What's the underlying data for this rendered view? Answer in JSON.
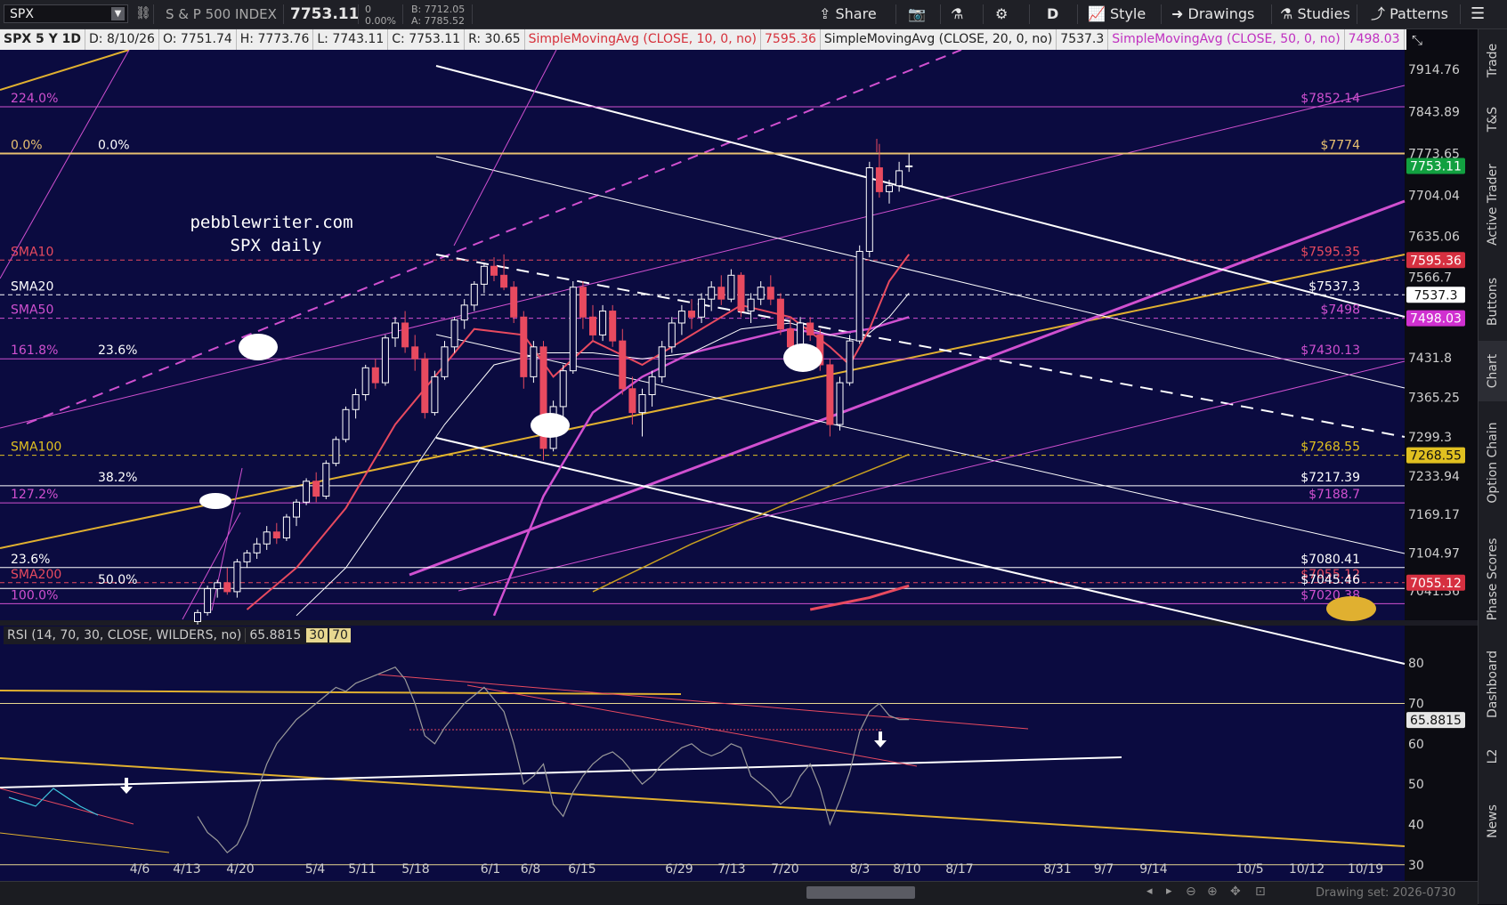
{
  "toolbar": {
    "symbol": "SPX",
    "description": "S & P 500 INDEX",
    "last": "7753.11",
    "change": "0",
    "change_pct": "0.00%",
    "bid": "B: 7712.05",
    "ask": "A: 7785.52",
    "share": "Share",
    "period": "D",
    "style": "Style",
    "drawings": "Drawings",
    "studies": "Studies",
    "patterns": "Patterns"
  },
  "info": {
    "chart_id": "SPX 5 Y 1D",
    "date": "D: 8/10/26",
    "open": "O: 7751.74",
    "high": "H: 7773.76",
    "low": "L: 7743.11",
    "close": "C: 7753.11",
    "range": "R: 30.65",
    "sma10_label": "SimpleMovingAvg (CLOSE, 10, 0, no)",
    "sma10_val": "7595.36",
    "sma20_label": "SimpleMovingAvg (CLOSE, 20, 0, no)",
    "sma20_val": "7537.3",
    "sma50_label": "SimpleMovingAvg (CLOSE, 50, 0, no)",
    "sma50_val": "7498.03"
  },
  "sidebar": [
    "Trade",
    "T&S",
    "Active Trader",
    "Buttons",
    "Chart",
    "Option Chain",
    "Phase Scores",
    "Dashboard",
    "L2",
    "News"
  ],
  "bottom": {
    "drawing_set": "Drawing set: 2026-0730"
  },
  "colors": {
    "bg": "#0b0b3f",
    "up": "#ffffff",
    "down": "#e84a5f",
    "fib": "#d050d0",
    "gold": "#e0b030",
    "grid": "#ffffff"
  },
  "chart_data": [
    {
      "type": "candlestick",
      "title": "SPX daily",
      "watermark": "pebblewriter.com",
      "price_axis": [
        "7914.76",
        "7843.89",
        "7773.65",
        "7704.04",
        "7635.06",
        "7566.7",
        "7498.03",
        "7431.8",
        "7365.25",
        "7299.3",
        "7233.94",
        "7169.17",
        "7104.97",
        "7041.36"
      ],
      "date_axis": [
        "4/6",
        "4/13",
        "4/20",
        "5/4",
        "5/11",
        "5/18",
        "6/1",
        "6/8",
        "6/15",
        "6/29",
        "7/13",
        "7/20",
        "8/3",
        "8/10",
        "8/17",
        "8/31",
        "9/7",
        "9/14",
        "10/5",
        "10/12",
        "10/19"
      ],
      "badges": [
        {
          "label": "7753.11",
          "color": "#12a040"
        },
        {
          "label": "7595.36",
          "color": "#d63040"
        },
        {
          "label": "7537.3",
          "color": "#ffffff"
        },
        {
          "label": "7498.03",
          "color": "#d030d0"
        },
        {
          "label": "7268.55",
          "color": "#e0c020"
        },
        {
          "label": "7055.12",
          "color": "#d63040"
        }
      ],
      "hlines": [
        {
          "price": 7852.14,
          "color": "#d050d0",
          "left": "224.0%",
          "right": "$7852.14"
        },
        {
          "price": 7774,
          "color": "#e8c070",
          "left": "0.0%",
          "mid": "0.0%",
          "right": "$7774"
        },
        {
          "price": 7595.36,
          "color": "#e84a5f",
          "left": "SMA10",
          "right": "$7595.35",
          "dashed": true
        },
        {
          "price": 7537.3,
          "color": "#ffffff",
          "left": "SMA20",
          "right": "$7537.3",
          "dashed": true
        },
        {
          "price": 7498,
          "color": "#d050d0",
          "left": "SMA50",
          "right": "$7498",
          "dashed": true
        },
        {
          "price": 7430,
          "color": "#d050d0",
          "left": "161.8%",
          "mid": "23.6%",
          "right": "$7430.13"
        },
        {
          "price": 7268.55,
          "color": "#e0c020",
          "left": "SMA100",
          "right": "$7268.55",
          "dashed": true
        },
        {
          "price": 7217.39,
          "color": "#ffffff",
          "mid": "38.2%",
          "right": "$7217.39"
        },
        {
          "price": 7188.7,
          "color": "#d050d0",
          "left": "127.2%",
          "right": "$7188.7"
        },
        {
          "price": 7080.41,
          "color": "#ffffff",
          "left": "23.6%",
          "right": "$7080.41"
        },
        {
          "price": 7055.12,
          "color": "#e84a5f",
          "left": "SMA200",
          "right": "$7055.12",
          "dashed": true
        },
        {
          "price": 7045.46,
          "color": "#ffffff",
          "mid": "50.0%",
          "right": "$7045.46"
        },
        {
          "price": 7020,
          "color": "#d050d0",
          "left": "100.0%",
          "right": "$7020.38"
        }
      ],
      "candles": [
        [
          6990,
          7010,
          6985,
          7005
        ],
        [
          7005,
          7050,
          7000,
          7045
        ],
        [
          7045,
          7060,
          7030,
          7055
        ],
        [
          7055,
          7080,
          7035,
          7040
        ],
        [
          7040,
          7095,
          7030,
          7090
        ],
        [
          7090,
          7110,
          7080,
          7105
        ],
        [
          7105,
          7130,
          7095,
          7120
        ],
        [
          7120,
          7150,
          7110,
          7140
        ],
        [
          7140,
          7155,
          7120,
          7130
        ],
        [
          7130,
          7170,
          7125,
          7165
        ],
        [
          7165,
          7195,
          7150,
          7190
        ],
        [
          7190,
          7230,
          7185,
          7225
        ],
        [
          7225,
          7240,
          7190,
          7200
        ],
        [
          7200,
          7260,
          7195,
          7255
        ],
        [
          7255,
          7300,
          7250,
          7295
        ],
        [
          7295,
          7350,
          7290,
          7345
        ],
        [
          7345,
          7380,
          7330,
          7370
        ],
        [
          7370,
          7420,
          7360,
          7415
        ],
        [
          7415,
          7430,
          7380,
          7390
        ],
        [
          7390,
          7470,
          7385,
          7465
        ],
        [
          7465,
          7500,
          7450,
          7490
        ],
        [
          7490,
          7510,
          7440,
          7450
        ],
        [
          7450,
          7470,
          7410,
          7430
        ],
        [
          7430,
          7440,
          7330,
          7340
        ],
        [
          7340,
          7410,
          7335,
          7400
        ],
        [
          7400,
          7460,
          7395,
          7450
        ],
        [
          7450,
          7500,
          7440,
          7495
        ],
        [
          7495,
          7530,
          7480,
          7520
        ],
        [
          7520,
          7560,
          7510,
          7555
        ],
        [
          7555,
          7590,
          7540,
          7585
        ],
        [
          7585,
          7600,
          7560,
          7570
        ],
        [
          7570,
          7605,
          7545,
          7550
        ],
        [
          7550,
          7560,
          7490,
          7500
        ],
        [
          7500,
          7510,
          7380,
          7400
        ],
        [
          7400,
          7460,
          7390,
          7450
        ],
        [
          7450,
          7460,
          7260,
          7280
        ],
        [
          7280,
          7360,
          7275,
          7350
        ],
        [
          7350,
          7420,
          7330,
          7410
        ],
        [
          7410,
          7560,
          7405,
          7550
        ],
        [
          7550,
          7560,
          7480,
          7500
        ],
        [
          7500,
          7520,
          7460,
          7470
        ],
        [
          7470,
          7520,
          7460,
          7510
        ],
        [
          7510,
          7520,
          7450,
          7460
        ],
        [
          7460,
          7480,
          7370,
          7380
        ],
        [
          7380,
          7400,
          7320,
          7340
        ],
        [
          7340,
          7380,
          7300,
          7370
        ],
        [
          7370,
          7410,
          7350,
          7400
        ],
        [
          7400,
          7460,
          7390,
          7450
        ],
        [
          7450,
          7500,
          7440,
          7490
        ],
        [
          7490,
          7520,
          7470,
          7510
        ],
        [
          7510,
          7530,
          7480,
          7500
        ],
        [
          7500,
          7540,
          7490,
          7530
        ],
        [
          7530,
          7560,
          7510,
          7550
        ],
        [
          7550,
          7570,
          7520,
          7530
        ],
        [
          7530,
          7580,
          7525,
          7570
        ],
        [
          7570,
          7575,
          7500,
          7510
        ],
        [
          7510,
          7540,
          7490,
          7530
        ],
        [
          7530,
          7560,
          7520,
          7550
        ],
        [
          7550,
          7570,
          7520,
          7530
        ],
        [
          7530,
          7540,
          7470,
          7480
        ],
        [
          7480,
          7500,
          7440,
          7450
        ],
        [
          7450,
          7500,
          7445,
          7490
        ],
        [
          7490,
          7500,
          7460,
          7470
        ],
        [
          7470,
          7480,
          7410,
          7420
        ],
        [
          7420,
          7430,
          7300,
          7320
        ],
        [
          7320,
          7400,
          7310,
          7390
        ],
        [
          7390,
          7470,
          7385,
          7460
        ],
        [
          7460,
          7620,
          7455,
          7610
        ],
        [
          7610,
          7760,
          7600,
          7750
        ],
        [
          7750,
          7790,
          7700,
          7710
        ],
        [
          7710,
          7730,
          7690,
          7720
        ],
        [
          7720,
          7760,
          7710,
          7745
        ],
        [
          7751.74,
          7773.76,
          7743.11,
          7753.11
        ]
      ],
      "sma10": [
        [
          5,
          7010
        ],
        [
          10,
          7080
        ],
        [
          15,
          7180
        ],
        [
          20,
          7320
        ],
        [
          25,
          7420
        ],
        [
          28,
          7480
        ],
        [
          33,
          7470
        ],
        [
          36,
          7400
        ],
        [
          40,
          7460
        ],
        [
          45,
          7420
        ],
        [
          50,
          7470
        ],
        [
          55,
          7520
        ],
        [
          60,
          7500
        ],
        [
          64,
          7450
        ],
        [
          66,
          7420
        ],
        [
          68,
          7480
        ],
        [
          70,
          7560
        ],
        [
          72,
          7605
        ]
      ],
      "sma20": [
        [
          10,
          7000
        ],
        [
          15,
          7080
        ],
        [
          20,
          7200
        ],
        [
          25,
          7320
        ],
        [
          30,
          7420
        ],
        [
          35,
          7440
        ],
        [
          40,
          7440
        ],
        [
          45,
          7430
        ],
        [
          50,
          7440
        ],
        [
          55,
          7480
        ],
        [
          60,
          7490
        ],
        [
          64,
          7470
        ],
        [
          67,
          7460
        ],
        [
          70,
          7500
        ],
        [
          72,
          7540
        ]
      ],
      "sma50": [
        [
          30,
          7000
        ],
        [
          35,
          7200
        ],
        [
          40,
          7340
        ],
        [
          45,
          7400
        ],
        [
          50,
          7440
        ],
        [
          55,
          7460
        ],
        [
          60,
          7480
        ],
        [
          64,
          7470
        ],
        [
          68,
          7480
        ],
        [
          72,
          7500
        ]
      ],
      "sma100": [
        [
          40,
          7040
        ],
        [
          50,
          7120
        ],
        [
          60,
          7190
        ],
        [
          66,
          7230
        ],
        [
          72,
          7270
        ]
      ],
      "sma200": [
        [
          62,
          7010
        ],
        [
          68,
          7030
        ],
        [
          72,
          7050
        ]
      ]
    },
    {
      "type": "line",
      "title": "RSI (14, 70, 30, CLOSE, WILDERS, no)",
      "value": "65.8815",
      "levels": [
        "30",
        "70"
      ],
      "y_axis": [
        "80",
        "70",
        "60",
        "50",
        "40",
        "30"
      ],
      "ylim": [
        22,
        86
      ],
      "rsi": [
        42,
        38,
        36,
        33,
        35,
        40,
        48,
        55,
        60,
        63,
        66,
        68,
        70,
        72,
        74,
        73,
        75,
        76,
        77,
        78,
        79,
        76,
        70,
        62,
        60,
        64,
        67,
        70,
        72,
        74,
        71,
        68,
        60,
        50,
        52,
        55,
        45,
        42,
        48,
        52,
        55,
        57,
        58,
        56,
        53,
        50,
        52,
        55,
        57,
        59,
        60,
        58,
        57,
        58,
        60,
        59,
        52,
        50,
        48,
        45,
        47,
        52,
        55,
        49,
        40,
        46,
        53,
        63,
        68,
        70,
        67,
        66,
        66
      ]
    }
  ]
}
